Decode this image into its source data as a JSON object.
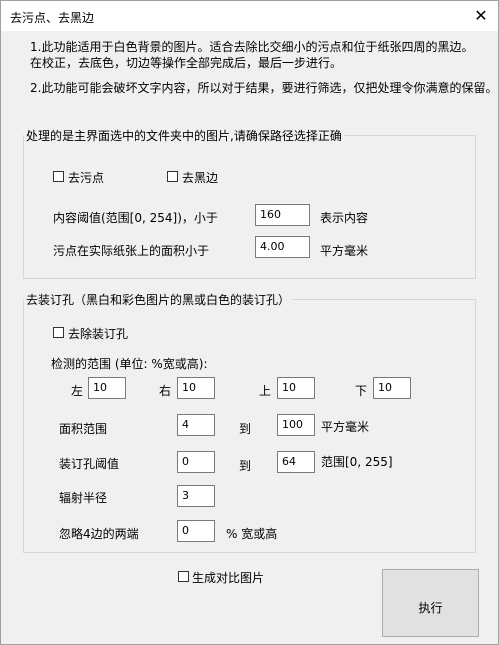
{
  "window": {
    "title": "去污点、去黑边",
    "close_glyph": "✕"
  },
  "notes": {
    "line1": "1.此功能适用于白色背景的图片。适合去除比交细小的污点和位于纸张四周的黑边。",
    "line2": "在校正，去底色，切边等操作全部完成后，最后一步进行。",
    "line3": "2.此功能可能会破坏文字内容，所以对于结果，要进行筛选，仅把处理令你满意的保留。"
  },
  "group1": {
    "legend": "处理的是主界面选中的文件夹中的图片,请确保路径选择正确",
    "remove_spots_label": "去污点",
    "remove_spots_checked": false,
    "remove_black_edges_label": "去黑边",
    "remove_black_edges_checked": false,
    "content_threshold_label": "内容阈值(范围[0, 254])，小于",
    "content_threshold_value": "160",
    "content_threshold_suffix": "表示内容",
    "spot_area_label": "污点在实际纸张上的面积小于",
    "spot_area_value": "4.00",
    "spot_area_suffix": "平方毫米"
  },
  "group2": {
    "legend": "去装订孔（黑白和彩色图片的黑或白色的装订孔）",
    "remove_holes_label": "去除装订孔",
    "remove_holes_checked": false,
    "detect_range_label": "检测的范围 (单位: %宽或高):",
    "left_label": "左",
    "left_value": "10",
    "right_label": "右",
    "right_value": "10",
    "top_label": "上",
    "top_value": "10",
    "bottom_label": "下",
    "bottom_value": "10",
    "area_range_label": "面积范围",
    "area_min": "4",
    "to_label_1": "到",
    "area_max": "100",
    "area_unit": "平方毫米",
    "hole_threshold_label": "装订孔阈值",
    "hole_threshold_min": "0",
    "to_label_2": "到",
    "hole_threshold_max": "64",
    "hole_threshold_range": "范围[0, 255]",
    "radiation_radius_label": "辐射半径",
    "radiation_radius_value": "3",
    "ignore_ends_label": "忽略4边的两端",
    "ignore_ends_value": "0",
    "ignore_ends_unit": "% 宽或高"
  },
  "footer": {
    "generate_compare_label": "生成对比图片",
    "generate_compare_checked": false,
    "execute_label": "执行"
  }
}
